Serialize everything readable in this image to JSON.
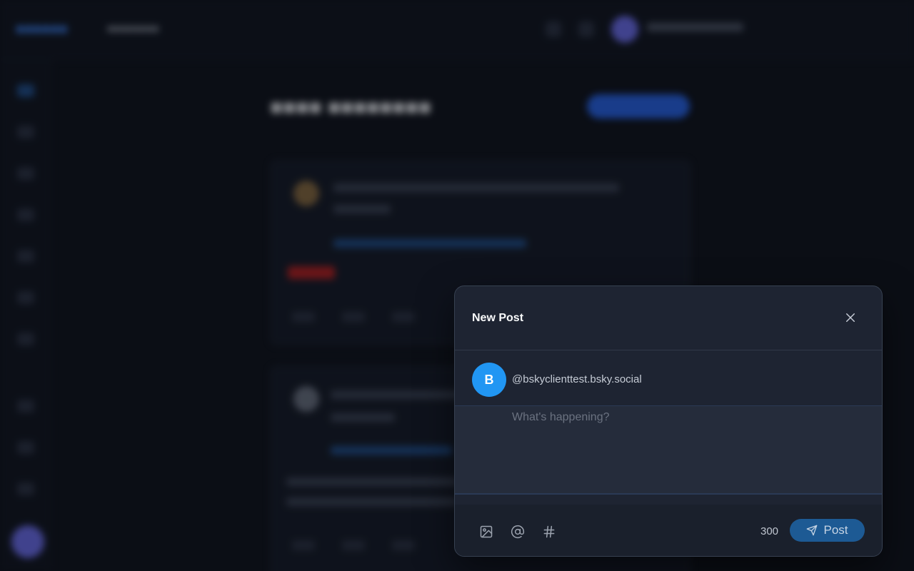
{
  "modal": {
    "title": "New Post",
    "user": {
      "avatar_initial": "B",
      "handle": "@bskyclienttest.bsky.social",
      "avatar_color": "#2196f3"
    },
    "compose": {
      "placeholder": "What's happening?",
      "value": ""
    },
    "toolbar": {
      "icons": [
        "image-icon",
        "mention-icon",
        "hashtag-icon"
      ]
    },
    "char_count": "300",
    "post_label": "Post",
    "accent_color": "#1d5a94"
  }
}
